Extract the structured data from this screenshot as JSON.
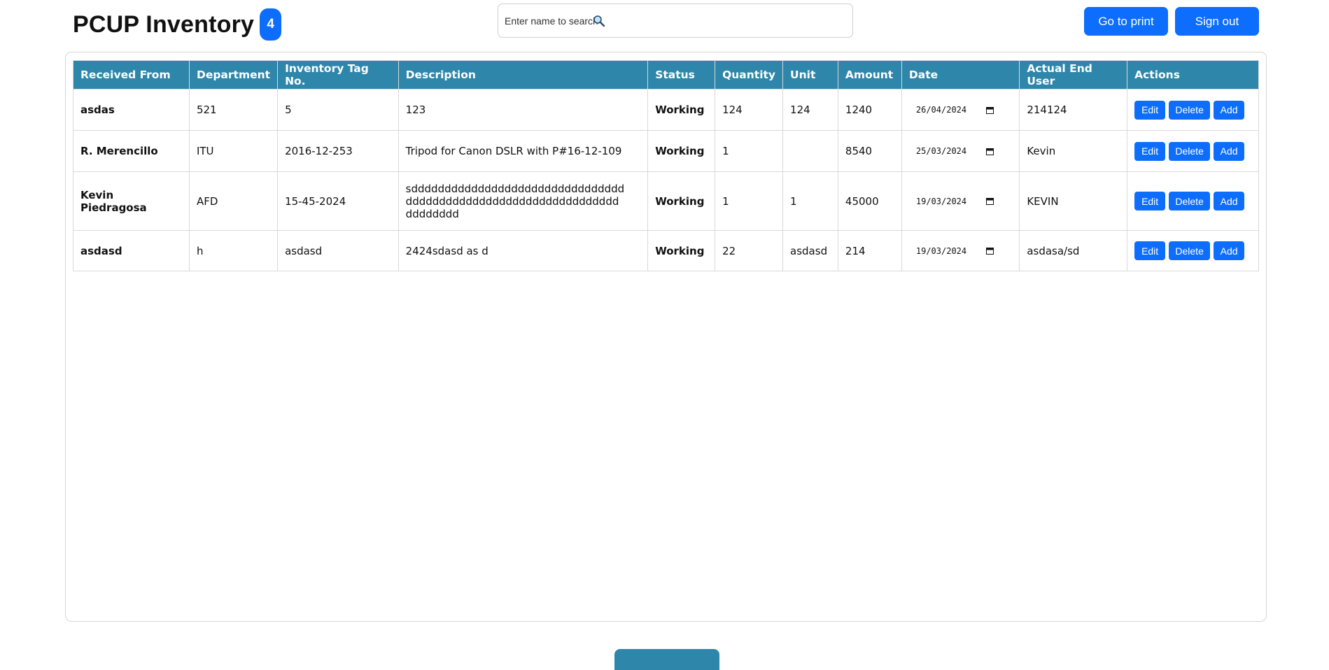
{
  "header": {
    "title": "PCUP Inventory",
    "count_badge": "4",
    "search": {
      "placeholder": "Enter name to search",
      "icon": "magnifier-icon"
    },
    "go_to_print": "Go to print",
    "sign_out": "Sign out"
  },
  "colors": {
    "primary": "#0d6efd",
    "table_header": "#2e86ab",
    "status_working": "#0a7d0a"
  },
  "table": {
    "columns": [
      "Received From",
      "Department",
      "Inventory Tag No.",
      "Description",
      "Status",
      "Quantity",
      "Unit",
      "Amount",
      "Date",
      "Actual End User",
      "Actions"
    ],
    "actions": {
      "edit": "Edit",
      "delete": "Delete",
      "add": "Add"
    },
    "rows": [
      {
        "received_from": "asdas",
        "department": "521",
        "tag": "5",
        "description": [
          "123"
        ],
        "status": "Working",
        "quantity": "124",
        "unit": "124",
        "amount": "1240",
        "date": "26/04/2024",
        "end_user": "214124"
      },
      {
        "received_from": "R. Merencillo",
        "department": "ITU",
        "tag": "2016-12-253",
        "description": [
          "Tripod for Canon DSLR with P#16-12-109"
        ],
        "status": "Working",
        "quantity": "1",
        "unit": "",
        "amount": "8540",
        "date": "25/03/2024",
        "end_user": "Kevin"
      },
      {
        "received_from": "Kevin Piedragosa",
        "department": "AFD",
        "tag": "15-45-2024",
        "description": [
          "sdddddddddddddddddddddddddddddddd",
          "dddddddddddddddddddddddddddddddd",
          "dddddddd"
        ],
        "status": "Working",
        "quantity": "1",
        "unit": "1",
        "amount": "45000",
        "date": "19/03/2024",
        "end_user": "KEVIN"
      },
      {
        "received_from": "asdasd",
        "department": "h",
        "tag": "asdasd",
        "description": [
          "2424sdasd as d"
        ],
        "status": "Working",
        "quantity": "22",
        "unit": "asdasd",
        "amount": "214",
        "date": "19/03/2024",
        "end_user": "asdasa/sd"
      }
    ]
  }
}
